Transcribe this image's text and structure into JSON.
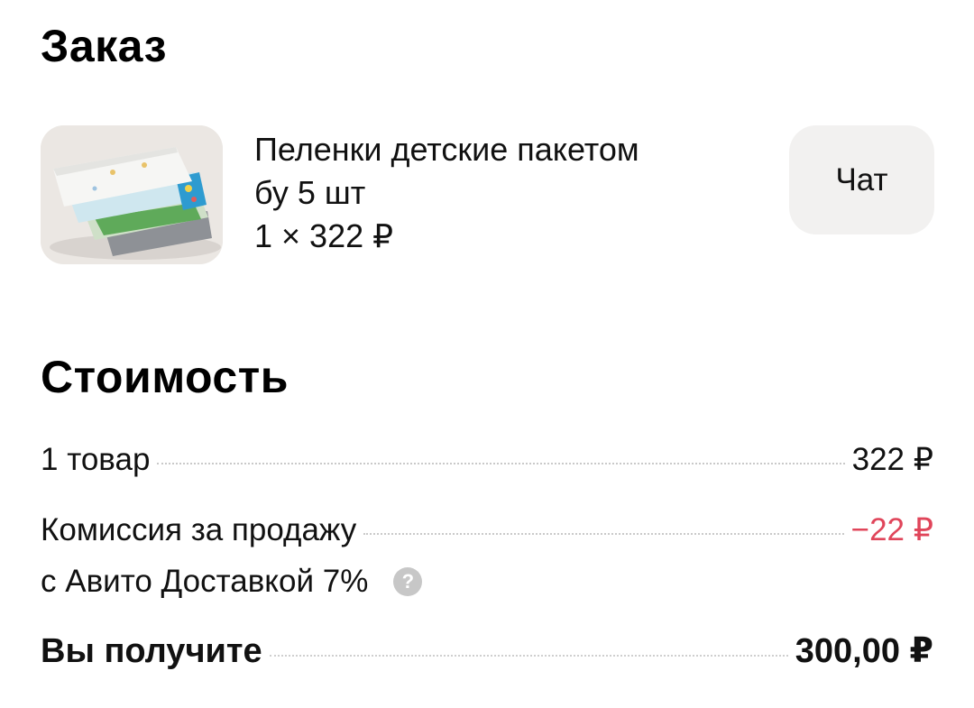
{
  "order": {
    "title": "Заказ",
    "item": {
      "name_line1": "Пеленки детские пакетом",
      "name_line2": "бу 5 шт",
      "quantity_price": "1 × 322 ₽",
      "image": "product-thumbnail"
    },
    "chat_label": "Чат"
  },
  "cost": {
    "title": "Стоимость",
    "goods_label": "1 товар",
    "goods_value": "322 ₽",
    "fee_label_line1": "Комиссия за продажу",
    "fee_label_line2": "с Авито Доставкой 7%",
    "fee_value": "−22 ₽",
    "help_icon": "question-icon",
    "total_label": "Вы получите",
    "total_value": "300,00 ₽"
  },
  "colors": {
    "negative": "#e0455a",
    "chat_bg": "#f2f1f0",
    "help_bg": "#c7c7c7"
  }
}
